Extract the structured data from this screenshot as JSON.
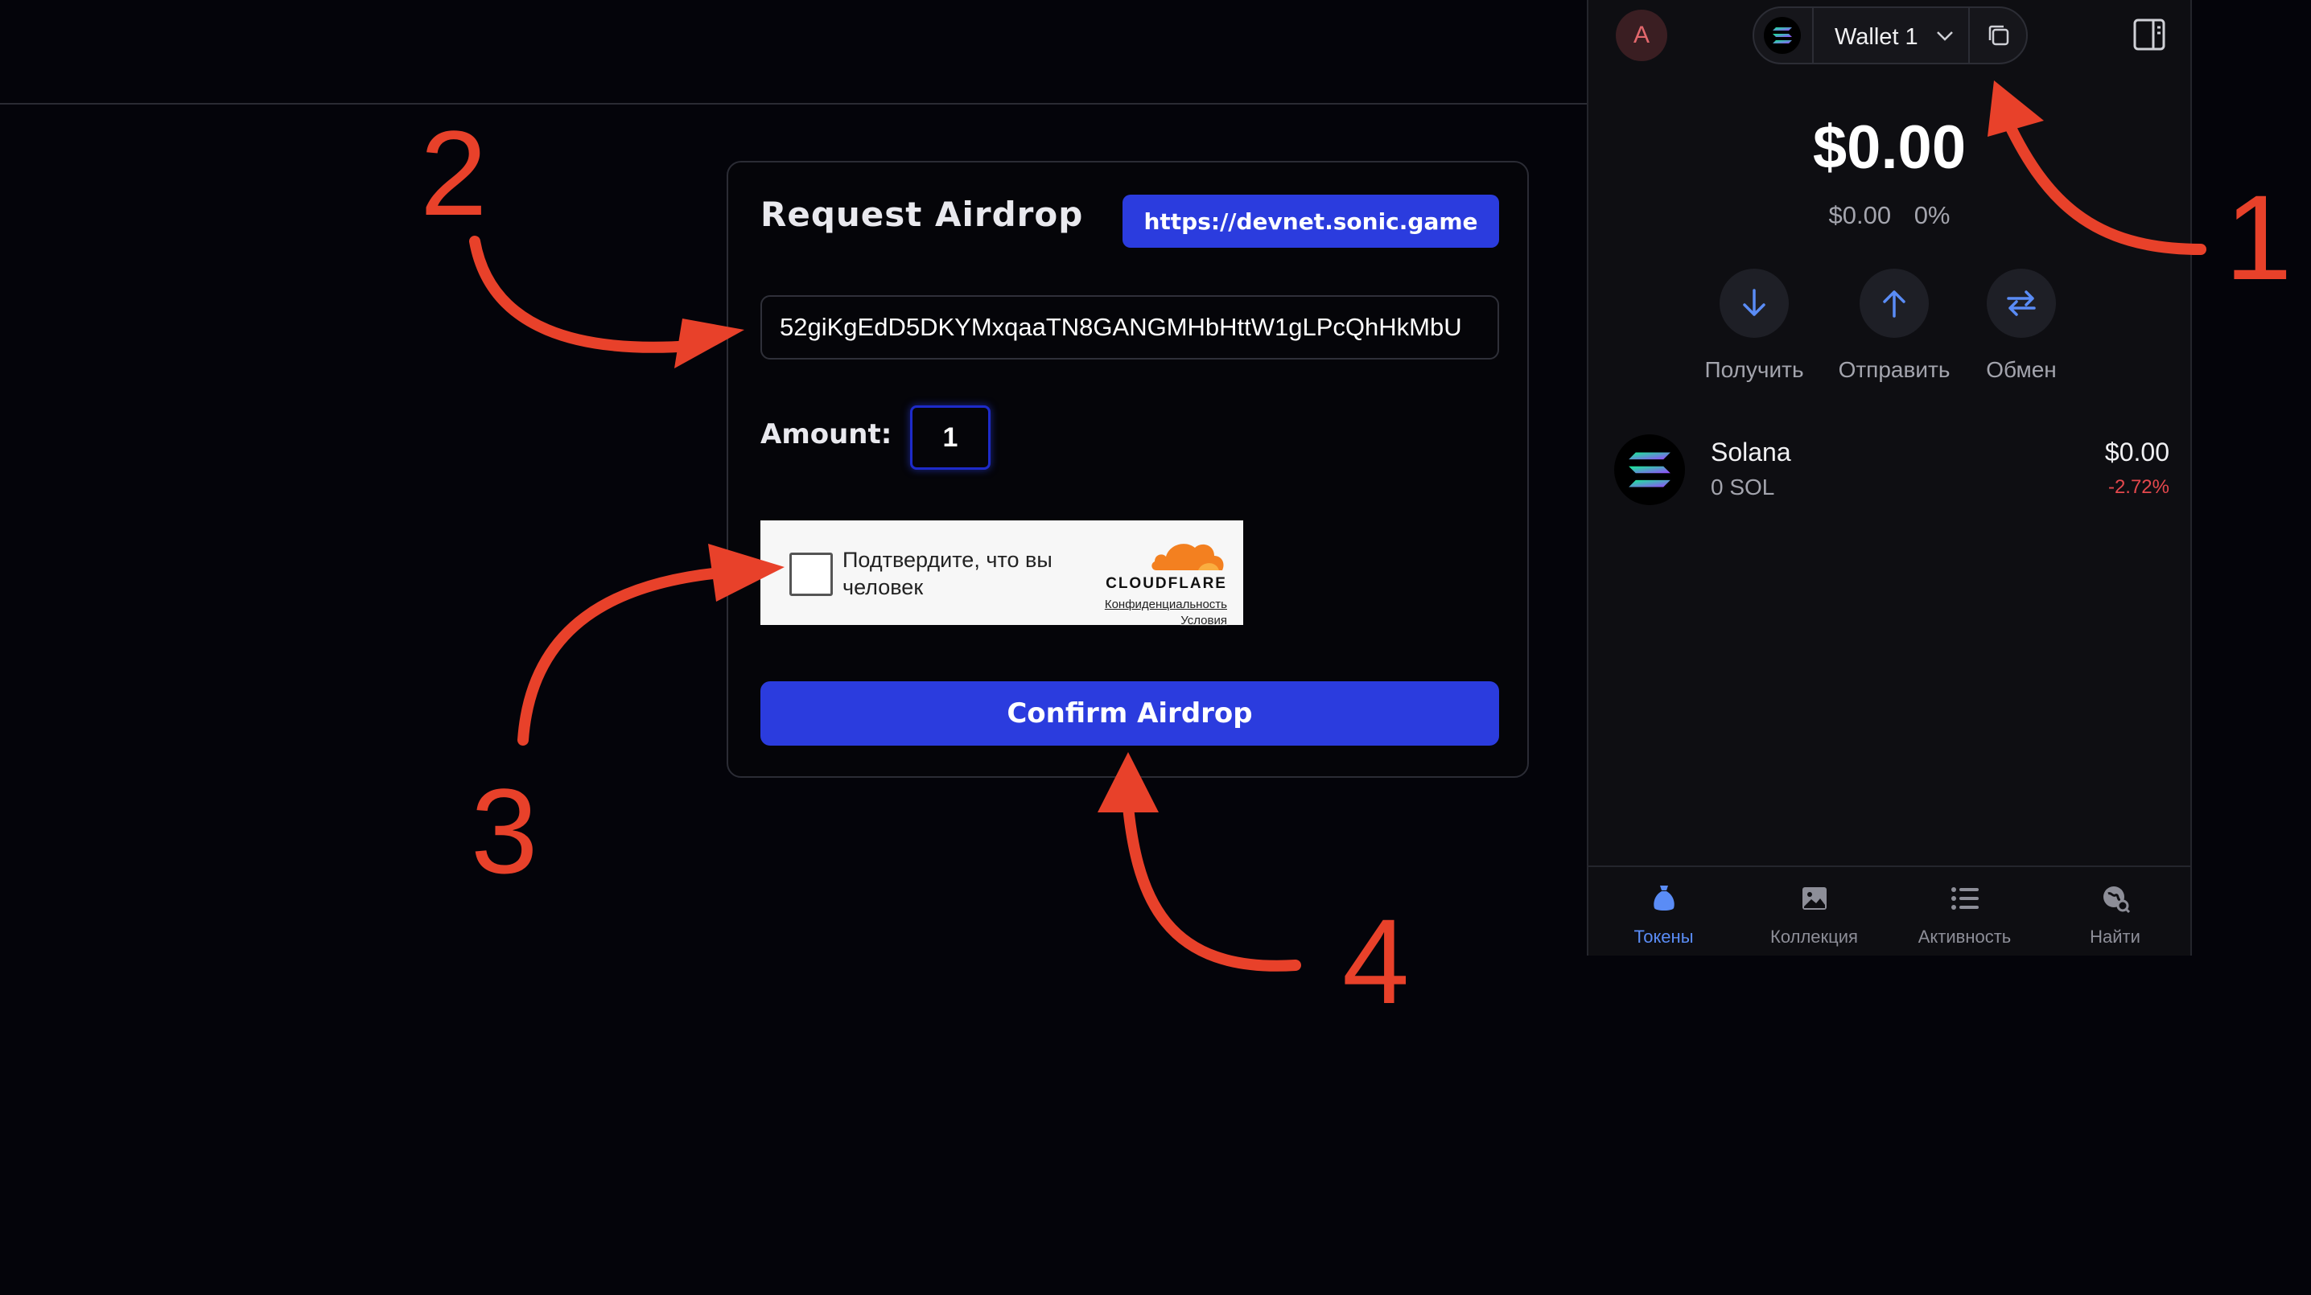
{
  "airdrop": {
    "title": "Request Airdrop",
    "network_url": "https://devnet.sonic.game",
    "address_value": "52giKgEdD5DKYMxqaaTN8GANGMHbHttW1gLPcQhHkMbU",
    "amount_label": "Amount:",
    "amount_value": "1",
    "captcha": {
      "prompt": "Подтвердите, что вы человек",
      "brand": "CLOUDFLARE",
      "privacy_link": "Конфиденциальность",
      "terms_link": "Условия"
    },
    "confirm_label": "Confirm Airdrop"
  },
  "wallet": {
    "avatar_letter": "A",
    "wallet_name": "Wallet 1",
    "balance": "$0.00",
    "balance_change_usd": "$0.00",
    "balance_change_pct": "0%",
    "actions": [
      {
        "label": "Получить",
        "icon": "arrow-down-icon"
      },
      {
        "label": "Отправить",
        "icon": "arrow-up-icon"
      },
      {
        "label": "Обмен",
        "icon": "swap-icon"
      }
    ],
    "tokens": [
      {
        "name": "Solana",
        "balance": "0 SOL",
        "usd": "$0.00",
        "change": "-2.72%"
      }
    ],
    "nav": [
      {
        "label": "Токены",
        "icon": "tokens-icon",
        "active": true
      },
      {
        "label": "Коллекция",
        "icon": "collection-icon",
        "active": false
      },
      {
        "label": "Активность",
        "icon": "activity-icon",
        "active": false
      },
      {
        "label": "Найти",
        "icon": "explore-icon",
        "active": false
      }
    ],
    "colors": {
      "accent": "#5a8cf6",
      "negative": "#e5484d"
    }
  },
  "annotations": {
    "step1": "1",
    "step2": "2",
    "step3": "3",
    "step4": "4",
    "color": "#e8412a"
  },
  "colors": {
    "primary_button": "#2b3cde",
    "background": "#04040a"
  }
}
